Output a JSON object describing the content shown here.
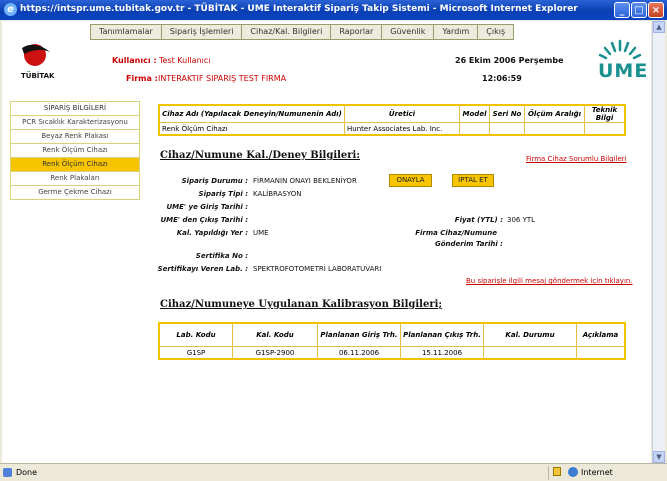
{
  "window": {
    "title": "https://intspr.ume.tubitak.gov.tr - TÜBİTAK - UME Interaktif Sipariş Takip Sistemi - Microsoft Internet Explorer"
  },
  "menu": [
    "Tanımlamalar",
    "Sipariş İşlemleri",
    "Cihaz/Kal. Bilgileri",
    "Raporlar",
    "Güvenlik",
    "Yardım",
    "Çıkış"
  ],
  "header": {
    "logo_text": "TÜBİTAK",
    "kullanici_label": "Kullanıcı :",
    "kullanici_value": "Test Kullanıcı",
    "firma_label": "Firma :",
    "firma_value": "INTERAKTIF SIPARIŞ TEST FIRMA",
    "date": "26 Ekim 2006 Perşembe",
    "time": "12:06:59",
    "ume_logo": "UME"
  },
  "sidebar": {
    "header": "SİPARİŞ BİLGİLERİ",
    "items": [
      "PCR Sıcaklık Karakterizasyonu",
      "Beyaz Renk Plakası",
      "Renk Ölçüm Cihazı",
      "Renk Ölçüm Cihazı",
      "Renk Plakaları",
      "Germe Çekme Cihazı"
    ],
    "active_index": 3
  },
  "device_table": {
    "headers": [
      "Cihaz Adı (Yapılacak Deneyin/Numunenin Adı)",
      "Üretici",
      "Model",
      "Seri No",
      "Ölçüm Aralığı",
      "Teknik Bilgi"
    ],
    "row": [
      "Renk Ölçüm Cihazı",
      "Hunter Associates Lab. Inc.",
      "",
      "",
      "",
      ""
    ]
  },
  "section1": {
    "title": "Cihaz/Numune Kal./Deney Bilgileri:",
    "firma_link": "Firma Cihaz Sorumlu Bilgileri",
    "siparis_durumu_label": "Sipariş Durumu :",
    "siparis_durumu_value": "FİRMANIN ONAYI BEKLENİYOR",
    "onayla": "ONAYLA",
    "iptal": "İPTAL ET",
    "siparis_tipi_label": "Sipariş Tipi :",
    "siparis_tipi_value": "KALİBRASYON",
    "giris_label": "UME' ye Giriş Tarihi :",
    "cikis_label": "UME' den Çıkış Tarihi :",
    "fiyat_label": "Fiyat (YTL) :",
    "fiyat_value": "306 YTL",
    "yer_label": "Kal. Yapıldığı Yer :",
    "yer_value": "UME",
    "firma_cihaz_label": "Firma Cihaz/Numune",
    "gonderim_label": "Gönderim Tarihi :",
    "sertifika_label": "Sertifika No :",
    "sertifika_lab_label": "Sertifikayı Veren Lab. :",
    "sertifika_lab_value": "SPEKTROFOTOMETRİ LABORATUVARI",
    "mesaj_link": "Bu siparişle ilgili mesaj göndermek için tıklayın."
  },
  "section2": {
    "title": "Cihaz/Numuneye Uygulanan Kalibrasyon Bilgileri;",
    "headers": [
      "Lab. Kodu",
      "Kal. Kodu",
      "Planlanan Giriş Trh.",
      "Planlanan Çıkış Trh.",
      "Kal. Durumu",
      "Açıklama"
    ],
    "row": [
      "G1SP",
      "G1SP-2900",
      "06.11.2006",
      "15.11.2006",
      "",
      ""
    ]
  },
  "status": {
    "left": "Done",
    "right": "Internet"
  }
}
